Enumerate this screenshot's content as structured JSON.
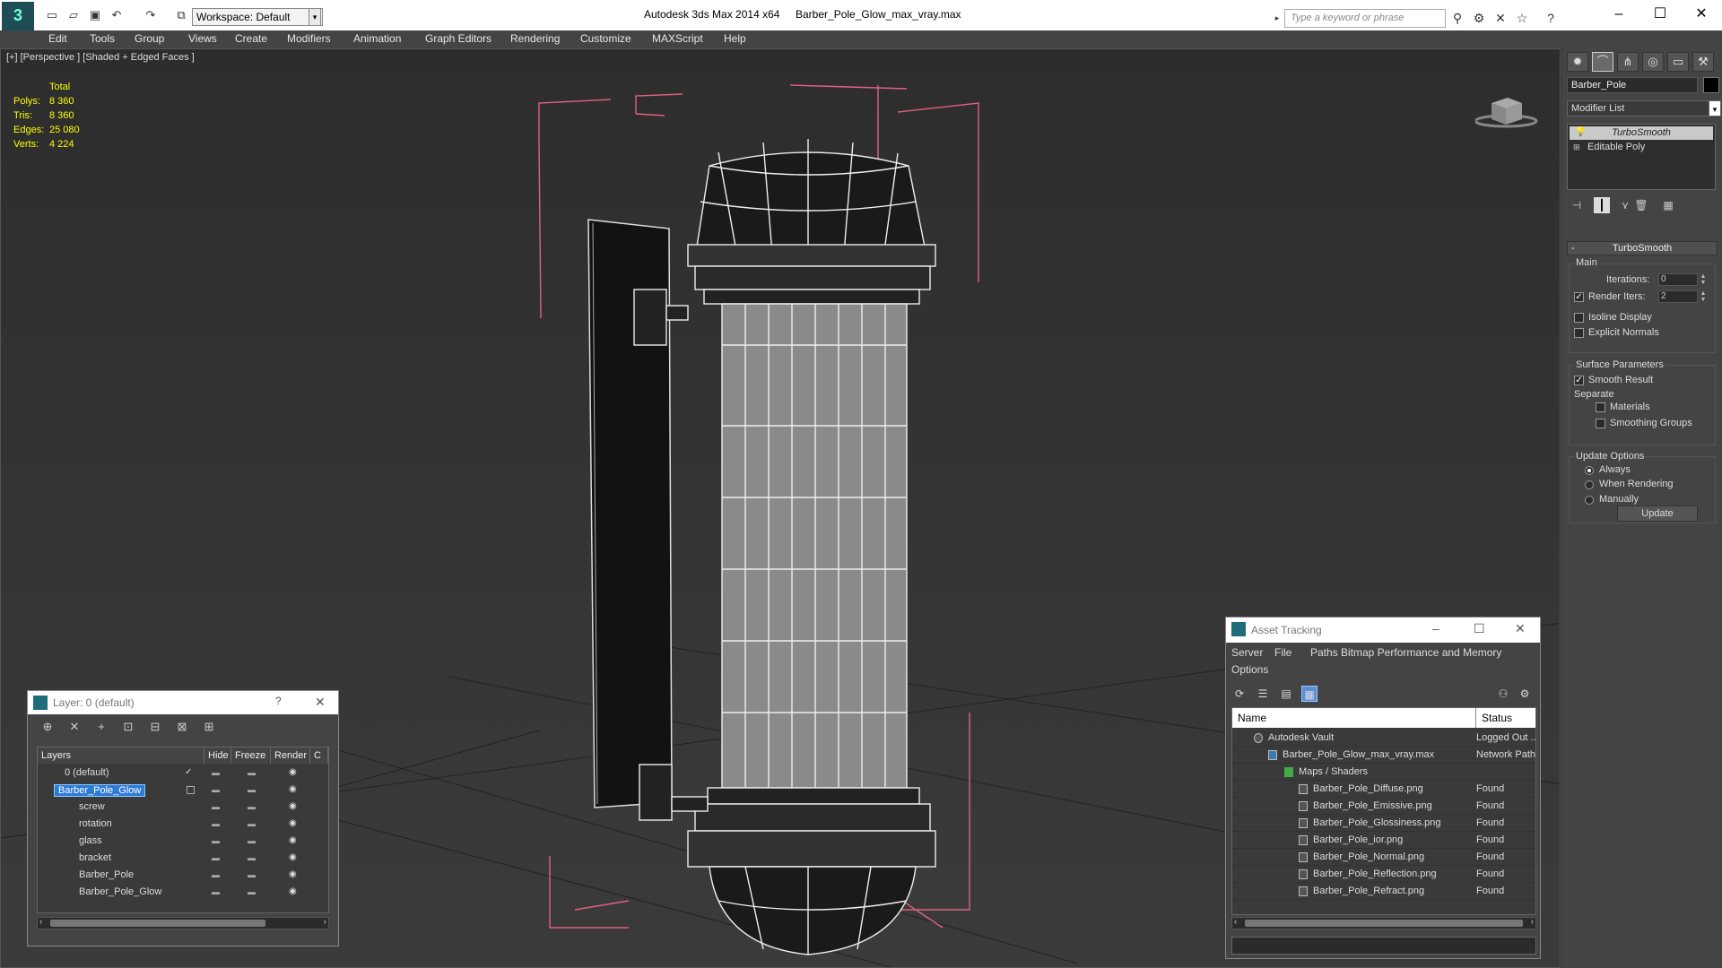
{
  "titlebar": {
    "workspace_label": "Workspace: Default",
    "app_name": "Autodesk 3ds Max  2014 x64",
    "file_name": "Barber_Pole_Glow_max_vray.max",
    "search_placeholder": "Type a keyword or phrase"
  },
  "menu": [
    "Edit",
    "Tools",
    "Group",
    "Views",
    "Create",
    "Modifiers",
    "Animation",
    "Graph Editors",
    "Rendering",
    "Customize",
    "MAXScript",
    "Help"
  ],
  "viewport": {
    "label": "[+] [Perspective ] [Shaded + Edged Faces ]",
    "stats_header": "Total",
    "stats": [
      {
        "label": "Polys:",
        "value": "8 360"
      },
      {
        "label": "Tris:",
        "value": "8 360"
      },
      {
        "label": "Edges:",
        "value": "25 080"
      },
      {
        "label": "Verts:",
        "value": "4 224"
      }
    ]
  },
  "command_panel": {
    "object_name": "Barber_Pole",
    "modifier_list": "Modifier List",
    "stack": [
      "TurboSmooth",
      "Editable Poly"
    ],
    "rollout_title": "TurboSmooth",
    "main_group": "Main",
    "iterations_label": "Iterations:",
    "iterations_value": "0",
    "render_iters_label": "Render Iters:",
    "render_iters_value": "2",
    "isoline_label": "Isoline Display",
    "explicit_normals_label": "Explicit Normals",
    "surface_group": "Surface Parameters",
    "smooth_result_label": "Smooth Result",
    "separate_label": "Separate",
    "materials_label": "Materials",
    "smoothing_groups_label": "Smoothing Groups",
    "update_group": "Update Options",
    "always_label": "Always",
    "when_rendering_label": "When Rendering",
    "manually_label": "Manually",
    "update_button": "Update"
  },
  "layer_window": {
    "title": "Layer: 0 (default)",
    "help": "?",
    "columns": [
      "Layers",
      "Hide",
      "Freeze",
      "Render",
      "C"
    ],
    "rows": [
      {
        "name": "0 (default)"
      },
      {
        "name": "Barber_Pole_Glow"
      },
      {
        "name": "screw"
      },
      {
        "name": "rotation"
      },
      {
        "name": "glass"
      },
      {
        "name": "bracket"
      },
      {
        "name": "Barber_Pole"
      },
      {
        "name": "Barber_Pole_Glow"
      }
    ]
  },
  "asset_window": {
    "title": "Asset Tracking",
    "menu": [
      "Server",
      "File",
      "Paths",
      "Bitmap Performance and Memory",
      "Options"
    ],
    "columns": [
      "Name",
      "Status"
    ],
    "rows": [
      {
        "name": "Autodesk Vault",
        "status": "Logged Out ..."
      },
      {
        "name": "Barber_Pole_Glow_max_vray.max",
        "status": "Network Path"
      },
      {
        "name": "Maps / Shaders",
        "status": ""
      },
      {
        "name": "Barber_Pole_Diffuse.png",
        "status": "Found"
      },
      {
        "name": "Barber_Pole_Emissive.png",
        "status": "Found"
      },
      {
        "name": "Barber_Pole_Glossiness.png",
        "status": "Found"
      },
      {
        "name": "Barber_Pole_ior.png",
        "status": "Found"
      },
      {
        "name": "Barber_Pole_Normal.png",
        "status": "Found"
      },
      {
        "name": "Barber_Pole_Reflection.png",
        "status": "Found"
      },
      {
        "name": "Barber_Pole_Refract.png",
        "status": "Found"
      }
    ]
  }
}
